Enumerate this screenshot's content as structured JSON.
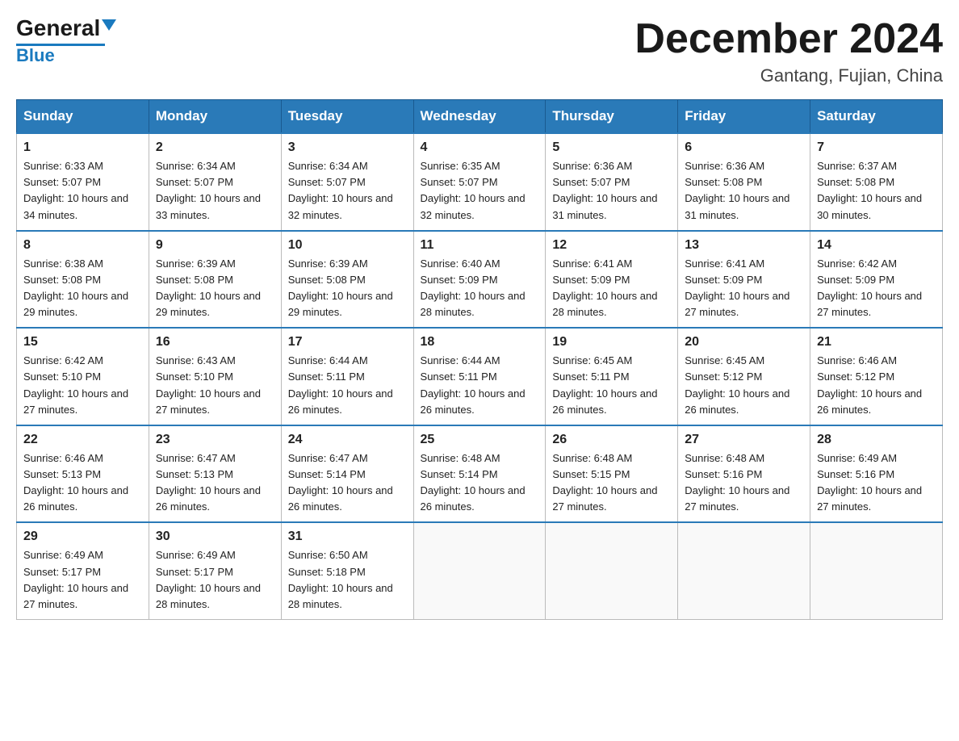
{
  "logo": {
    "text_general": "General",
    "text_blue": "Blue",
    "line_color": "#1a7abf"
  },
  "title": "December 2024",
  "subtitle": "Gantang, Fujian, China",
  "weekdays": [
    "Sunday",
    "Monday",
    "Tuesday",
    "Wednesday",
    "Thursday",
    "Friday",
    "Saturday"
  ],
  "weeks": [
    [
      {
        "num": "1",
        "sunrise": "6:33 AM",
        "sunset": "5:07 PM",
        "daylight": "10 hours and 34 minutes."
      },
      {
        "num": "2",
        "sunrise": "6:34 AM",
        "sunset": "5:07 PM",
        "daylight": "10 hours and 33 minutes."
      },
      {
        "num": "3",
        "sunrise": "6:34 AM",
        "sunset": "5:07 PM",
        "daylight": "10 hours and 32 minutes."
      },
      {
        "num": "4",
        "sunrise": "6:35 AM",
        "sunset": "5:07 PM",
        "daylight": "10 hours and 32 minutes."
      },
      {
        "num": "5",
        "sunrise": "6:36 AM",
        "sunset": "5:07 PM",
        "daylight": "10 hours and 31 minutes."
      },
      {
        "num": "6",
        "sunrise": "6:36 AM",
        "sunset": "5:08 PM",
        "daylight": "10 hours and 31 minutes."
      },
      {
        "num": "7",
        "sunrise": "6:37 AM",
        "sunset": "5:08 PM",
        "daylight": "10 hours and 30 minutes."
      }
    ],
    [
      {
        "num": "8",
        "sunrise": "6:38 AM",
        "sunset": "5:08 PM",
        "daylight": "10 hours and 29 minutes."
      },
      {
        "num": "9",
        "sunrise": "6:39 AM",
        "sunset": "5:08 PM",
        "daylight": "10 hours and 29 minutes."
      },
      {
        "num": "10",
        "sunrise": "6:39 AM",
        "sunset": "5:08 PM",
        "daylight": "10 hours and 29 minutes."
      },
      {
        "num": "11",
        "sunrise": "6:40 AM",
        "sunset": "5:09 PM",
        "daylight": "10 hours and 28 minutes."
      },
      {
        "num": "12",
        "sunrise": "6:41 AM",
        "sunset": "5:09 PM",
        "daylight": "10 hours and 28 minutes."
      },
      {
        "num": "13",
        "sunrise": "6:41 AM",
        "sunset": "5:09 PM",
        "daylight": "10 hours and 27 minutes."
      },
      {
        "num": "14",
        "sunrise": "6:42 AM",
        "sunset": "5:09 PM",
        "daylight": "10 hours and 27 minutes."
      }
    ],
    [
      {
        "num": "15",
        "sunrise": "6:42 AM",
        "sunset": "5:10 PM",
        "daylight": "10 hours and 27 minutes."
      },
      {
        "num": "16",
        "sunrise": "6:43 AM",
        "sunset": "5:10 PM",
        "daylight": "10 hours and 27 minutes."
      },
      {
        "num": "17",
        "sunrise": "6:44 AM",
        "sunset": "5:11 PM",
        "daylight": "10 hours and 26 minutes."
      },
      {
        "num": "18",
        "sunrise": "6:44 AM",
        "sunset": "5:11 PM",
        "daylight": "10 hours and 26 minutes."
      },
      {
        "num": "19",
        "sunrise": "6:45 AM",
        "sunset": "5:11 PM",
        "daylight": "10 hours and 26 minutes."
      },
      {
        "num": "20",
        "sunrise": "6:45 AM",
        "sunset": "5:12 PM",
        "daylight": "10 hours and 26 minutes."
      },
      {
        "num": "21",
        "sunrise": "6:46 AM",
        "sunset": "5:12 PM",
        "daylight": "10 hours and 26 minutes."
      }
    ],
    [
      {
        "num": "22",
        "sunrise": "6:46 AM",
        "sunset": "5:13 PM",
        "daylight": "10 hours and 26 minutes."
      },
      {
        "num": "23",
        "sunrise": "6:47 AM",
        "sunset": "5:13 PM",
        "daylight": "10 hours and 26 minutes."
      },
      {
        "num": "24",
        "sunrise": "6:47 AM",
        "sunset": "5:14 PM",
        "daylight": "10 hours and 26 minutes."
      },
      {
        "num": "25",
        "sunrise": "6:48 AM",
        "sunset": "5:14 PM",
        "daylight": "10 hours and 26 minutes."
      },
      {
        "num": "26",
        "sunrise": "6:48 AM",
        "sunset": "5:15 PM",
        "daylight": "10 hours and 27 minutes."
      },
      {
        "num": "27",
        "sunrise": "6:48 AM",
        "sunset": "5:16 PM",
        "daylight": "10 hours and 27 minutes."
      },
      {
        "num": "28",
        "sunrise": "6:49 AM",
        "sunset": "5:16 PM",
        "daylight": "10 hours and 27 minutes."
      }
    ],
    [
      {
        "num": "29",
        "sunrise": "6:49 AM",
        "sunset": "5:17 PM",
        "daylight": "10 hours and 27 minutes."
      },
      {
        "num": "30",
        "sunrise": "6:49 AM",
        "sunset": "5:17 PM",
        "daylight": "10 hours and 28 minutes."
      },
      {
        "num": "31",
        "sunrise": "6:50 AM",
        "sunset": "5:18 PM",
        "daylight": "10 hours and 28 minutes."
      },
      null,
      null,
      null,
      null
    ]
  ]
}
